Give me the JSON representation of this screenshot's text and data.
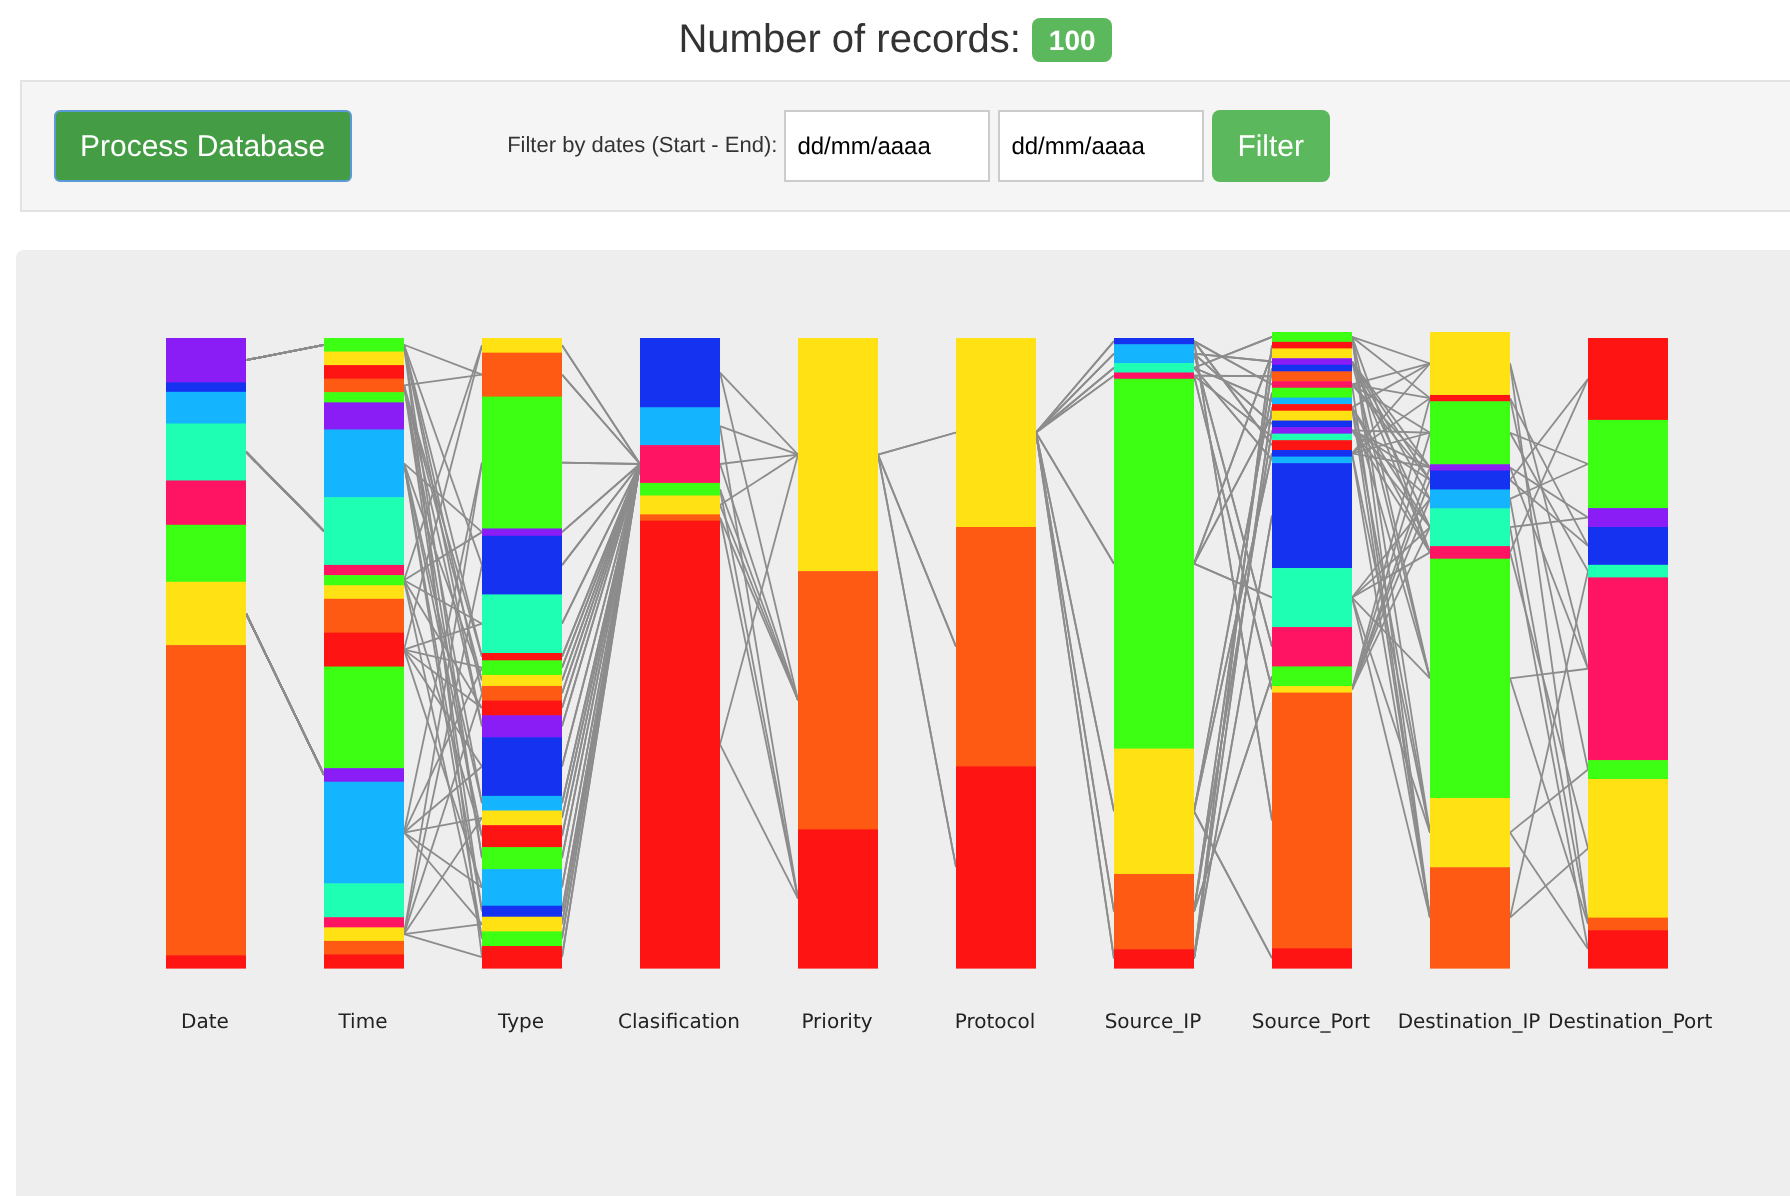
{
  "header": {
    "title": "Number of records:",
    "count": "100"
  },
  "toolbar": {
    "process_button": "Process Database",
    "filter_label": "Filter by dates (Start - End):",
    "start_date": {
      "value": "dd/mm/aaaa"
    },
    "end_date": {
      "value": "dd/mm/aaaa"
    },
    "filter_button": "Filter"
  },
  "chart": {
    "axes": [
      "Date",
      "Time",
      "Type",
      "Clasification",
      "Priority",
      "Protocol",
      "Source_IP",
      "Source_Port",
      "Destination_IP",
      "Destination_Port"
    ]
  }
}
